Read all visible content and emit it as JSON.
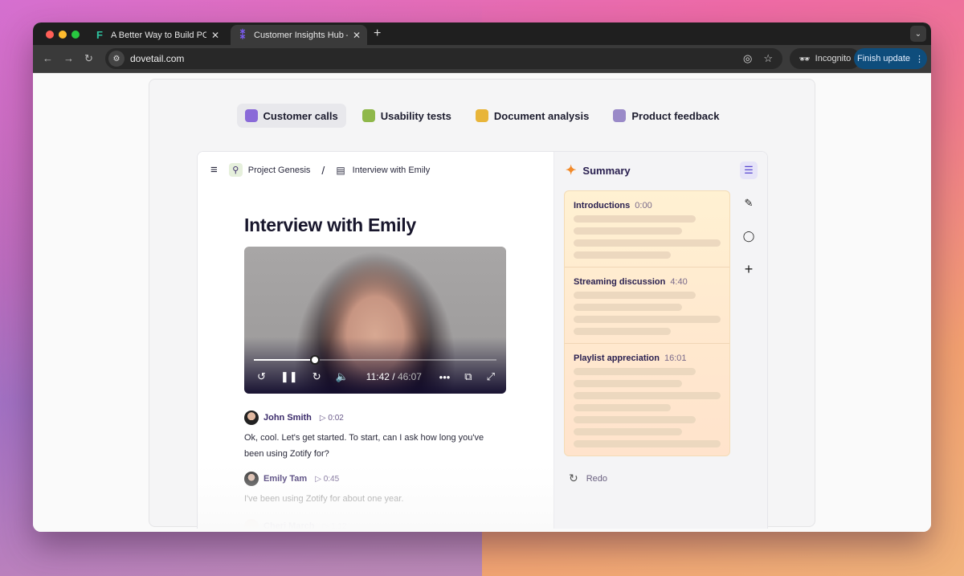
{
  "browser": {
    "tabs": [
      {
        "title": "A Better Way to Build PCBs | F",
        "favicon": "flux-logo-icon",
        "active": false
      },
      {
        "title": "Customer Insights Hub — Dov",
        "favicon": "dovetail-logo-icon",
        "active": true
      }
    ],
    "url": "dovetail.com",
    "incognito_label": "Incognito",
    "finish_update_label": "Finish update"
  },
  "categories": [
    {
      "label": "Customer calls",
      "active": true,
      "icon_color": "#8a6ad8"
    },
    {
      "label": "Usability tests",
      "active": false,
      "icon_color": "#8fb84a"
    },
    {
      "label": "Document analysis",
      "active": false,
      "icon_color": "#e8b53a"
    },
    {
      "label": "Product feedback",
      "active": false,
      "icon_color": "#9a8ac8"
    }
  ],
  "breadcrumb": {
    "project": "Project Genesis",
    "separator": "/",
    "document": "Interview with Emily"
  },
  "page_title": "Interview with Emily",
  "video": {
    "current": "11:42",
    "duration": "46:07",
    "progress": 0.253
  },
  "transcript": [
    {
      "speaker": "John Smith",
      "timestamp": "0:02",
      "text": "Ok, cool. Let's get started. To start, can I ask how long you've been using Zotify for?"
    },
    {
      "speaker": "Emily Tam",
      "timestamp": "0:45",
      "text": "I've been using Zotify for about one year."
    },
    {
      "speaker": "Cheri March",
      "timestamp": "1:12",
      "text": ""
    }
  ],
  "summary": {
    "title": "Summary",
    "sections": [
      {
        "title": "Introductions",
        "time": "0:00",
        "lines": 4
      },
      {
        "title": "Streaming discussion",
        "time": "4:40",
        "lines": 4
      },
      {
        "title": "Playlist appreciation",
        "time": "16:01",
        "lines": 7
      }
    ],
    "redo_label": "Redo"
  }
}
